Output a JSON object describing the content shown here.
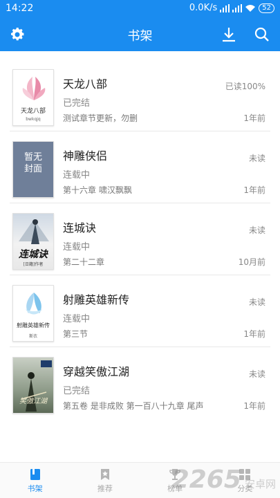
{
  "status_bar": {
    "time": "14:22",
    "network_speed": "0.0K/s",
    "battery": "52"
  },
  "header": {
    "title": "书架"
  },
  "books": [
    {
      "title": "天龙八部",
      "status": "已完结",
      "latest_chapter": "测试章节更新，勿删",
      "progress": "已读100%",
      "updated": "1年前",
      "cover_type": "art",
      "cover_title": "天龙八部",
      "cover_author": "bwkqjq"
    },
    {
      "title": "神雕侠侣",
      "status": "连载中",
      "latest_chapter": "第十六章 啸汉飘飘",
      "progress": "未读",
      "updated": "1年前",
      "cover_type": "placeholder",
      "cover_title": "暂无封面"
    },
    {
      "title": "连城诀",
      "status": "连载中",
      "latest_chapter": "第二十二章",
      "progress": "未读",
      "updated": "10月前",
      "cover_type": "art",
      "cover_title": "连城诀",
      "cover_author": "[日籍]作者"
    },
    {
      "title": "射雕英雄新传",
      "status": "连载中",
      "latest_chapter": "第三节",
      "progress": "未读",
      "updated": "1年前",
      "cover_type": "art",
      "cover_title": "射雕英雄新传",
      "cover_author": "斯衣"
    },
    {
      "title": "穿越笑傲江湖",
      "status": "已完结",
      "latest_chapter": "第五卷 是非成败 第一百八十九章 尾声",
      "progress": "未读",
      "updated": "1年前",
      "cover_type": "art",
      "cover_title": "笑傲江湖"
    }
  ],
  "bottom_nav": [
    {
      "label": "书架",
      "icon": "bookshelf-icon",
      "active": true
    },
    {
      "label": "推荐",
      "icon": "bookmark-star-icon",
      "active": false
    },
    {
      "label": "榜单",
      "icon": "trophy-icon",
      "active": false
    },
    {
      "label": "分类",
      "icon": "category-icon",
      "active": false
    }
  ],
  "watermark": {
    "number": "2265",
    "suffix": "安卓网"
  },
  "colors": {
    "primary": "#1a8cf0",
    "placeholder_cover": "#6f7f99"
  }
}
